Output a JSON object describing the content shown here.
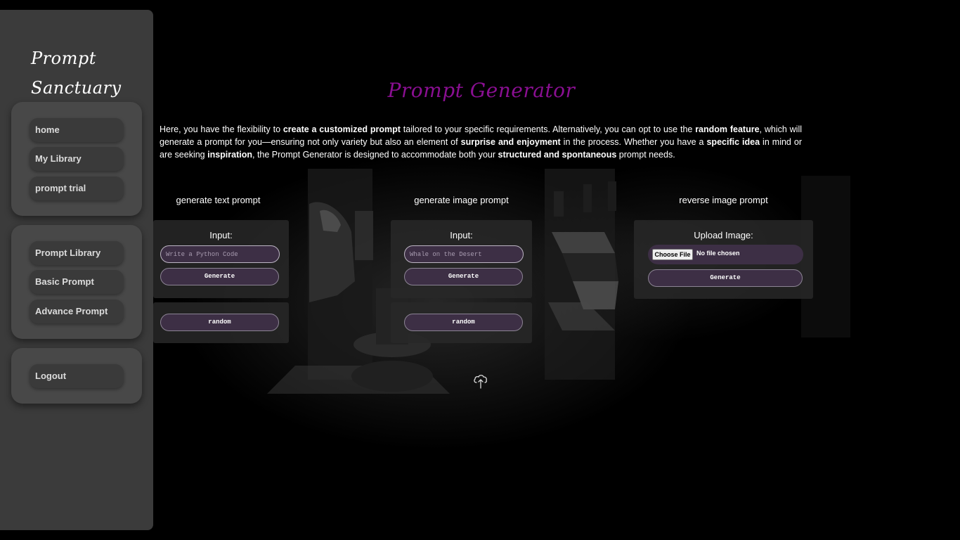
{
  "brand": {
    "line1": "Prompt",
    "line2": "Sanctuary"
  },
  "sidebar": {
    "group1": [
      {
        "label": "home"
      },
      {
        "label": "My Library"
      },
      {
        "label": "prompt trial"
      }
    ],
    "group2": [
      {
        "label": "Prompt Library"
      },
      {
        "label": "Basic Prompt"
      },
      {
        "label": "Advance Prompt"
      }
    ],
    "group3": [
      {
        "label": "Logout"
      }
    ]
  },
  "main": {
    "title": "Prompt Generator",
    "intro": {
      "p1": "Here, you have the flexibility to ",
      "b1": "create a customized prompt",
      "p2": " tailored to your specific requirements. Alternatively, you can opt to use the ",
      "b2": "random feature",
      "p3": ", which will generate a prompt for you—ensuring not only variety but also an element of ",
      "b3": "surprise and enjoyment",
      "p4": " in the process. Whether you have a ",
      "b4": "specific idea",
      "p5": " in mind or are seeking ",
      "b5": "inspiration",
      "p6": ", the Prompt Generator is designed to accommodate both your ",
      "b6": "structured and spontaneous",
      "p7": " prompt needs."
    },
    "text_prompt": {
      "title": "generate text prompt",
      "input_label": "Input:",
      "placeholder": "Write a Python Code",
      "generate": "Generate",
      "random": "random"
    },
    "image_prompt": {
      "title": "generate image prompt",
      "input_label": "Input:",
      "placeholder": "Whale on the Desert",
      "generate": "Generate",
      "random": "random"
    },
    "reverse_prompt": {
      "title": "reverse image prompt",
      "upload_label": "Upload Image:",
      "choose_file": "Choose File",
      "no_file": "No file chosen",
      "generate": "Generate"
    }
  },
  "icons": {
    "upload": "cloud-upload-icon"
  },
  "colors": {
    "title": "#8a0f92",
    "button": "#3d2f45",
    "sidebar": "#3b3b3b"
  }
}
